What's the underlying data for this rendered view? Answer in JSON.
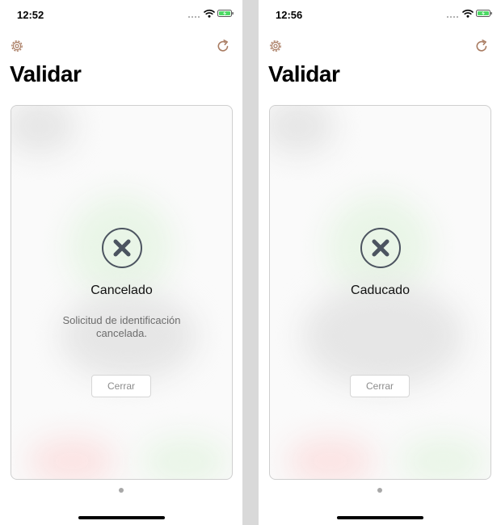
{
  "colors": {
    "accent": "#a97c62",
    "status_icon": "#4c5460",
    "battery_charge": "#4cd964",
    "background": "#ffffff"
  },
  "screens": [
    {
      "status_bar": {
        "time": "12:52"
      },
      "top_bar": {
        "settings_icon": "gear-icon",
        "refresh_icon": "refresh-icon"
      },
      "title": "Validar",
      "card": {
        "icon": "close-circle-icon",
        "status_title": "Cancelado",
        "message": "Solicitud de identificación\ncancelada.",
        "close_label": "Cerrar"
      },
      "page_indicator": {
        "pages": 1,
        "current": 1
      }
    },
    {
      "status_bar": {
        "time": "12:56"
      },
      "top_bar": {
        "settings_icon": "gear-icon",
        "refresh_icon": "refresh-icon"
      },
      "title": "Validar",
      "card": {
        "icon": "close-circle-icon",
        "status_title": "Caducado",
        "message": "",
        "close_label": "Cerrar"
      },
      "page_indicator": {
        "pages": 1,
        "current": 1
      }
    }
  ]
}
